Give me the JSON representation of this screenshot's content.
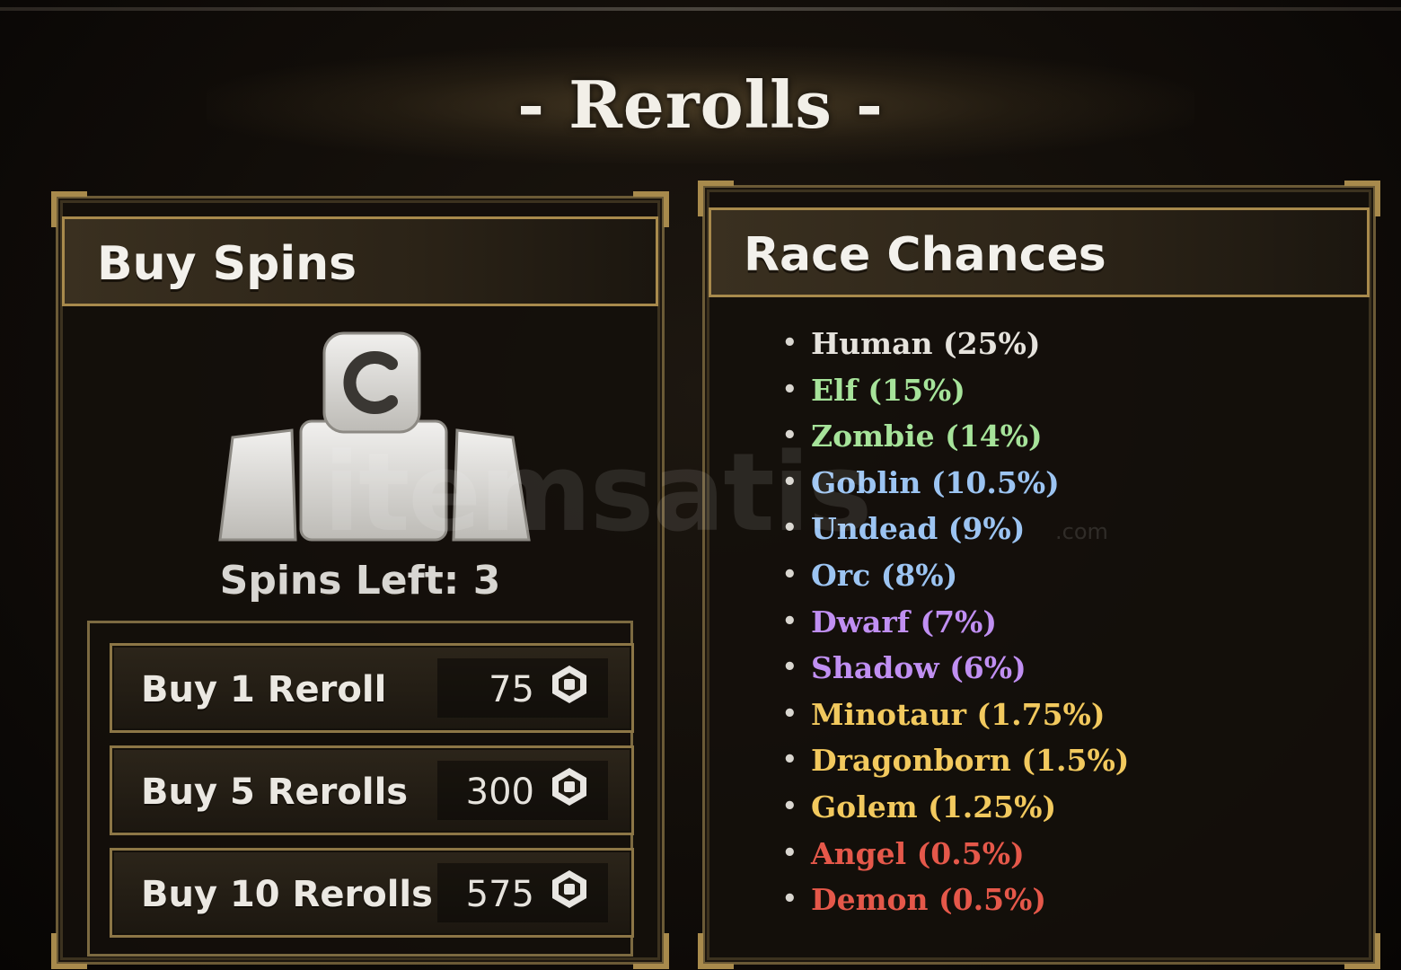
{
  "title": "- Rerolls -",
  "buy_panel": {
    "header": "Buy Spins",
    "icon": "spin-pack-icon",
    "spins_left": "Spins Left: 3",
    "buttons": [
      {
        "label": "Buy 1 Reroll",
        "price": "75",
        "currency_icon": "robux-icon"
      },
      {
        "label": "Buy 5 Rerolls",
        "price": "300",
        "currency_icon": "robux-icon"
      },
      {
        "label": "Buy 10 Rerolls",
        "price": "575",
        "currency_icon": "robux-icon"
      }
    ]
  },
  "race_panel": {
    "header": "Race Chances",
    "items": [
      {
        "text": "Human (25%)",
        "color": "#e6e3dd"
      },
      {
        "text": "Elf (15%)",
        "color": "#a6e39a"
      },
      {
        "text": "Zombie (14%)",
        "color": "#a6e39a"
      },
      {
        "text": "Goblin (10.5%)",
        "color": "#9cc4f2"
      },
      {
        "text": "Undead (9%)",
        "color": "#9cc4f2"
      },
      {
        "text": "Orc (8%)",
        "color": "#9cc4f2"
      },
      {
        "text": "Dwarf (7%)",
        "color": "#c08ff2"
      },
      {
        "text": "Shadow (6%)",
        "color": "#c08ff2"
      },
      {
        "text": "Minotaur (1.75%)",
        "color": "#f2c95e"
      },
      {
        "text": "Dragonborn (1.5%)",
        "color": "#f2c95e"
      },
      {
        "text": "Golem (1.25%)",
        "color": "#f2c95e"
      },
      {
        "text": "Angel (0.5%)",
        "color": "#e5584a"
      },
      {
        "text": "Demon (0.5%)",
        "color": "#e5584a"
      }
    ]
  },
  "watermark": "itemsatis",
  "watermark_sub": ".com"
}
